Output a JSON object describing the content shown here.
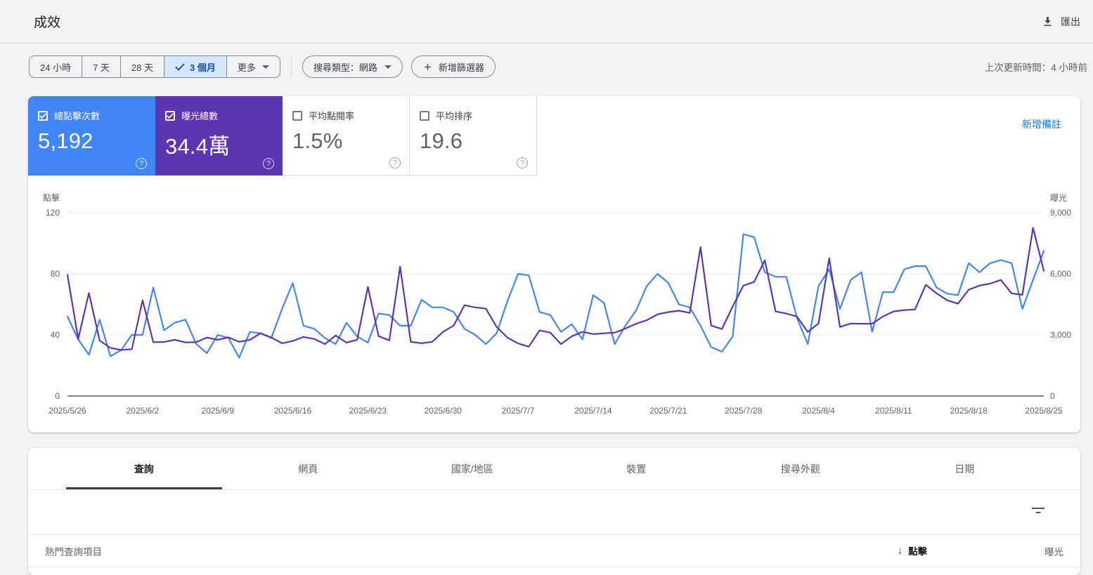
{
  "header": {
    "title": "成效",
    "export_label": "匯出"
  },
  "toolbar": {
    "date_filters": [
      "24 小時",
      "7 天",
      "28 天",
      "3 個月",
      "更多"
    ],
    "selected_filter_index": 3,
    "search_type_label": "搜尋類型：網路",
    "add_filter_label": "新增篩選器",
    "last_updated": "上次更新時間：4 小時前"
  },
  "metrics": {
    "cards": [
      {
        "label": "總點擊次數",
        "value": "5,192",
        "checked": true,
        "color": "#4285f4"
      },
      {
        "label": "曝光總數",
        "value": "34.4萬",
        "checked": true,
        "color": "#5e35b1"
      },
      {
        "label": "平均點閱率",
        "value": "1.5%",
        "checked": false,
        "color": "#ffffff"
      },
      {
        "label": "平均排序",
        "value": "19.6",
        "checked": false,
        "color": "#ffffff"
      }
    ],
    "add_note_label": "新增備註"
  },
  "chart_data": {
    "type": "line",
    "grid": true,
    "legend_position": "none",
    "left_axis": {
      "label": "點擊",
      "ticks": [
        0,
        40,
        80,
        120
      ],
      "tick_labels": [
        "0",
        "40",
        "80",
        "120"
      ],
      "max": 120
    },
    "right_axis": {
      "label": "曝光",
      "ticks": [
        0,
        3000,
        6000,
        9000
      ],
      "tick_labels": [
        "0",
        "3,000",
        "6,000",
        "9,000"
      ],
      "max": 9000
    },
    "x_tick_labels": [
      "2025/5/26",
      "2025/6/2",
      "2025/6/9",
      "2025/6/16",
      "2025/6/23",
      "2025/6/30",
      "2025/7/7",
      "2025/7/14",
      "2025/7/21",
      "2025/7/28",
      "2025/8/4",
      "2025/8/11",
      "2025/8/18",
      "2025/8/25"
    ],
    "dates": [
      "5/26",
      "5/27",
      "5/28",
      "5/29",
      "5/30",
      "5/31",
      "6/1",
      "6/2",
      "6/3",
      "6/4",
      "6/5",
      "6/6",
      "6/7",
      "6/8",
      "6/9",
      "6/10",
      "6/11",
      "6/12",
      "6/13",
      "6/14",
      "6/15",
      "6/16",
      "6/17",
      "6/18",
      "6/19",
      "6/20",
      "6/21",
      "6/22",
      "6/23",
      "6/24",
      "6/25",
      "6/26",
      "6/27",
      "6/28",
      "6/29",
      "6/30",
      "7/1",
      "7/2",
      "7/3",
      "7/4",
      "7/5",
      "7/6",
      "7/7",
      "7/8",
      "7/9",
      "7/10",
      "7/11",
      "7/12",
      "7/13",
      "7/14",
      "7/15",
      "7/16",
      "7/17",
      "7/18",
      "7/19",
      "7/20",
      "7/21",
      "7/22",
      "7/23",
      "7/24",
      "7/25",
      "7/26",
      "7/27",
      "7/28",
      "7/29",
      "7/30",
      "7/31",
      "8/1",
      "8/2",
      "8/3",
      "8/4",
      "8/5",
      "8/6",
      "8/7",
      "8/8",
      "8/9",
      "8/10",
      "8/11",
      "8/12",
      "8/13",
      "8/14",
      "8/15",
      "8/16",
      "8/17",
      "8/18",
      "8/19",
      "8/20",
      "8/21",
      "8/22",
      "8/23",
      "8/24",
      "8/25"
    ],
    "series": [
      {
        "name": "點擊",
        "axis": "left",
        "color": "#4285f4",
        "values": [
          52,
          37,
          27,
          50,
          26,
          30,
          40,
          40,
          71,
          43,
          48,
          50,
          34,
          28,
          40,
          38,
          25,
          42,
          41,
          38,
          57,
          74,
          46,
          44,
          38,
          34,
          48,
          39,
          35,
          54,
          53,
          46,
          46,
          63,
          58,
          58,
          55,
          44,
          40,
          34,
          41,
          62,
          80,
          79,
          55,
          53,
          42,
          47,
          37,
          66,
          61,
          34,
          46,
          56,
          72,
          80,
          74,
          60,
          58,
          46,
          32,
          29,
          39,
          106,
          104,
          81,
          78,
          78,
          51,
          34,
          72,
          83,
          57,
          76,
          81,
          42,
          68,
          68,
          83,
          85,
          85,
          71,
          67,
          66,
          87,
          81,
          87,
          89,
          87,
          57,
          76,
          95
        ]
      },
      {
        "name": "曝光",
        "axis": "right",
        "color": "#5e35b1",
        "values": [
          5950,
          2800,
          5060,
          2720,
          2360,
          2260,
          2300,
          4700,
          2640,
          2650,
          2760,
          2630,
          2640,
          2870,
          2760,
          2880,
          2660,
          2760,
          3080,
          2870,
          2590,
          2700,
          2900,
          2800,
          2550,
          2970,
          2620,
          2760,
          5360,
          2940,
          2730,
          6350,
          2660,
          2590,
          2660,
          3150,
          3460,
          4460,
          4350,
          4290,
          3390,
          2870,
          2580,
          2420,
          3220,
          3110,
          2550,
          2930,
          3150,
          3040,
          3080,
          3110,
          3310,
          3550,
          3720,
          4010,
          4120,
          4190,
          4080,
          7310,
          3460,
          3290,
          4400,
          5420,
          5600,
          6670,
          4150,
          4050,
          3900,
          3150,
          3560,
          6770,
          3390,
          3560,
          3550,
          3550,
          3900,
          4150,
          4220,
          4250,
          5460,
          5040,
          4700,
          4530,
          5220,
          5420,
          5520,
          5700,
          5040,
          4970,
          8260,
          6150
        ]
      }
    ]
  },
  "table": {
    "tabs": [
      "查詢",
      "網頁",
      "國家/地區",
      "裝置",
      "搜尋外觀",
      "日期"
    ],
    "active_tab_index": 0,
    "header": {
      "query_col": "熱門查詢項目",
      "clicks_col": "點擊",
      "impressions_col": "曝光",
      "sort_arrow": "↓"
    }
  }
}
